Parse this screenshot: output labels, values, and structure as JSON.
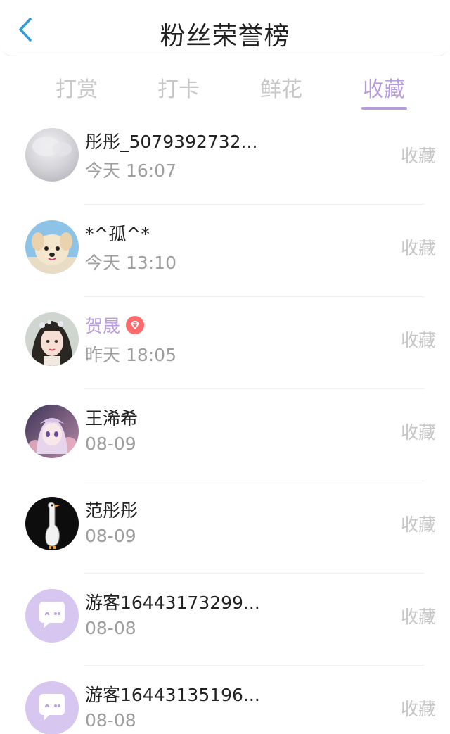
{
  "header": {
    "title": "粉丝荣誉榜"
  },
  "tabs": [
    {
      "label": "打赏",
      "active": false
    },
    {
      "label": "打卡",
      "active": false
    },
    {
      "label": "鲜花",
      "active": false
    },
    {
      "label": "收藏",
      "active": true
    }
  ],
  "colors": {
    "accent": "#b69cdc",
    "back_icon": "#2f9bdb",
    "badge": "#ff6b6b"
  },
  "list": [
    {
      "name": "彤彤_5079392732...",
      "time": "今天 16:07",
      "action": "收藏",
      "avatar": "gray-avatar"
    },
    {
      "name": "*^孤^*",
      "time": "今天 13:10",
      "action": "收藏",
      "avatar": "puppy-avatar"
    },
    {
      "name": "贺晟",
      "time": "昨天 18:05",
      "action": "收藏",
      "avatar": "girl-avatar",
      "vip": true,
      "badge_icon": "diamond-icon"
    },
    {
      "name": "王浠希",
      "time": "08-09",
      "action": "收藏",
      "avatar": "anime-avatar"
    },
    {
      "name": "范彤彤",
      "time": "08-09",
      "action": "收藏",
      "avatar": "goose-avatar"
    },
    {
      "name": "游客16443173299...",
      "time": "08-08",
      "action": "收藏",
      "avatar": "guest-avatar"
    },
    {
      "name": "游客16443135196...",
      "time": "08-08",
      "action": "收藏",
      "avatar": "guest-avatar"
    }
  ]
}
